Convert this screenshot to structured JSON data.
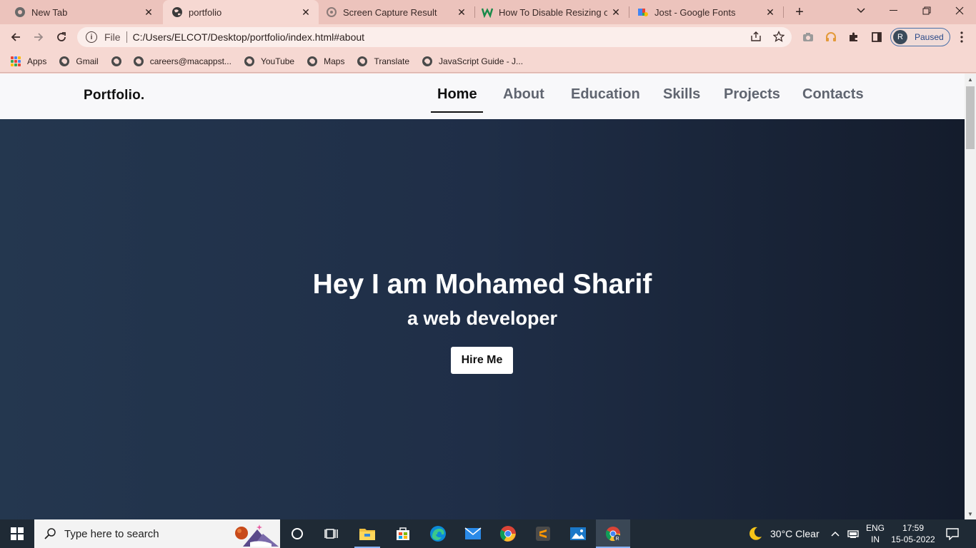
{
  "browser": {
    "tabs": [
      {
        "title": "New Tab",
        "icon": "chrome-icon",
        "active": false
      },
      {
        "title": "portfolio",
        "icon": "globe-icon",
        "active": true
      },
      {
        "title": "Screen Capture Result",
        "icon": "capture-icon",
        "active": false
      },
      {
        "title": "How To Disable Resizing of T",
        "icon": "w-logo-icon",
        "active": false
      },
      {
        "title": "Jost - Google Fonts",
        "icon": "google-fonts-icon",
        "active": false
      }
    ],
    "omnibox": {
      "chip": "File",
      "url": "C:/Users/ELCOT/Desktop/portfolio/index.html#about"
    },
    "profile": {
      "initial": "R",
      "status": "Paused"
    },
    "bookmarks": [
      {
        "label": "Apps",
        "icon": "apps-grid-icon"
      },
      {
        "label": "Gmail",
        "icon": "globe-icon"
      },
      {
        "label": "",
        "icon": "globe-icon"
      },
      {
        "label": "careers@macappst...",
        "icon": "globe-icon"
      },
      {
        "label": "YouTube",
        "icon": "globe-icon"
      },
      {
        "label": "Maps",
        "icon": "globe-icon"
      },
      {
        "label": "Translate",
        "icon": "globe-icon"
      },
      {
        "label": "JavaScript Guide - J...",
        "icon": "globe-icon"
      }
    ]
  },
  "site": {
    "logo": "Portfolio.",
    "nav": [
      {
        "label": "Home",
        "active": true
      },
      {
        "label": "About"
      },
      {
        "label": "Education"
      },
      {
        "label": "Skills"
      },
      {
        "label": "Projects"
      },
      {
        "label": "Contacts"
      }
    ],
    "hero": {
      "title": "Hey I am Mohamed Sharif",
      "subtitle": "a web developer",
      "cta": "Hire Me"
    }
  },
  "taskbar": {
    "search_placeholder": "Type here to search",
    "weather": "30°C  Clear",
    "lang_line1": "ENG",
    "lang_line2": "IN",
    "time": "17:59",
    "date": "15-05-2022"
  },
  "colors": {
    "hero_start": "#24374f",
    "hero_end": "#141c2c",
    "chrome_frame": "#ecc3bc",
    "toolbar": "#f6d8d2"
  }
}
